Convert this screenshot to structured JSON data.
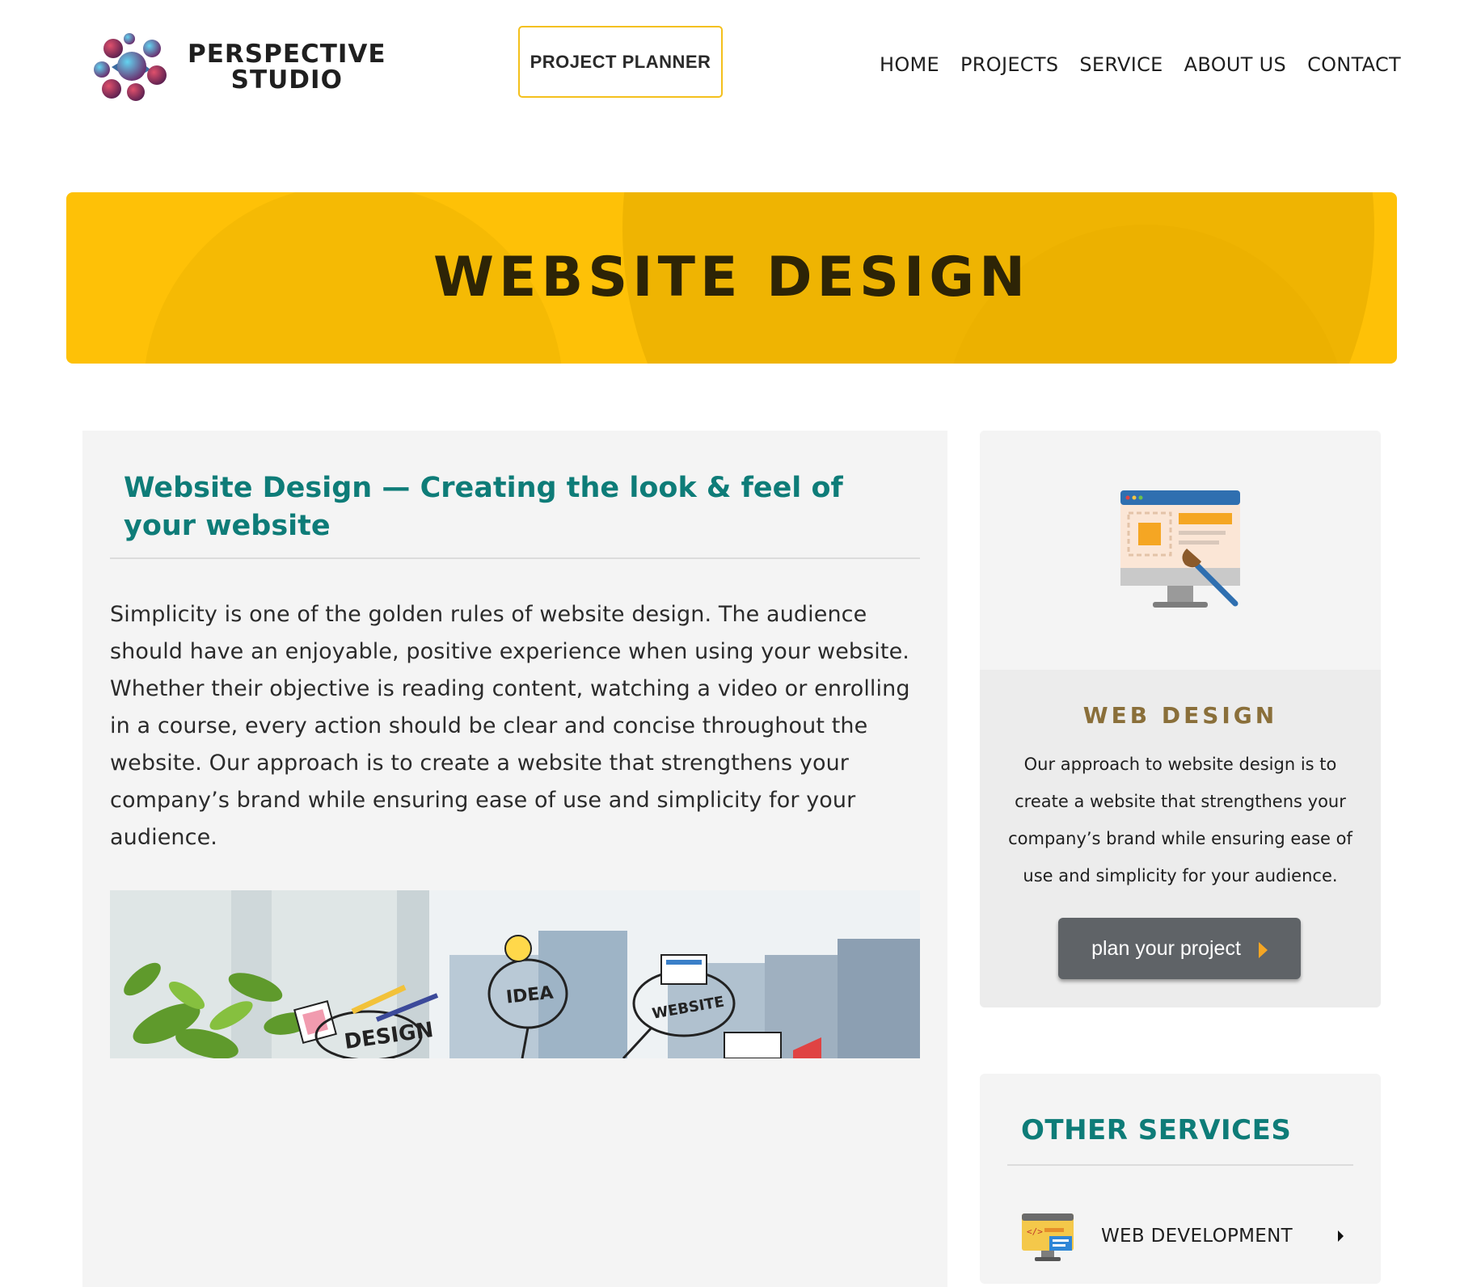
{
  "brand": {
    "line1": "PERSPECTIVE",
    "line2": "STUDIO"
  },
  "header": {
    "planner_label": "PROJECT PLANNER",
    "nav": [
      "HOME",
      "PROJECTS",
      "SERVICE",
      "ABOUT US",
      "CONTACT"
    ]
  },
  "hero": {
    "title": "WEBSITE DESIGN"
  },
  "main": {
    "title": "Website Design — Creating the look & feel of your website",
    "body": "Simplicity is one of the golden rules of website design. The audience should have an enjoyable, positive experience when using your website. Whether their objective is reading content, watching a video or enrolling in a course, every action should be clear and concise throughout the website. Our approach is to create a website that strengthens your company’s brand while ensuring ease of use and simplicity for your audience.",
    "banner_words": [
      "DESIGN",
      "IDEA",
      "WEBSITE"
    ]
  },
  "side": {
    "icon": "web-design-monitor-icon",
    "title": "WEB DESIGN",
    "text": "Our approach to website design is to create a website that strengthens your company’s brand while ensuring ease of use and simplicity for your audience.",
    "button_label": "plan your project"
  },
  "other": {
    "title": "OTHER SERVICES",
    "items": [
      {
        "label": "WEB DEVELOPMENT",
        "icon": "web-development-icon"
      }
    ]
  },
  "colors": {
    "accent_yellow": "#fec107",
    "teal": "#0e7c78",
    "gold_text": "#8a6f3a",
    "button_gray": "#5f6367"
  }
}
